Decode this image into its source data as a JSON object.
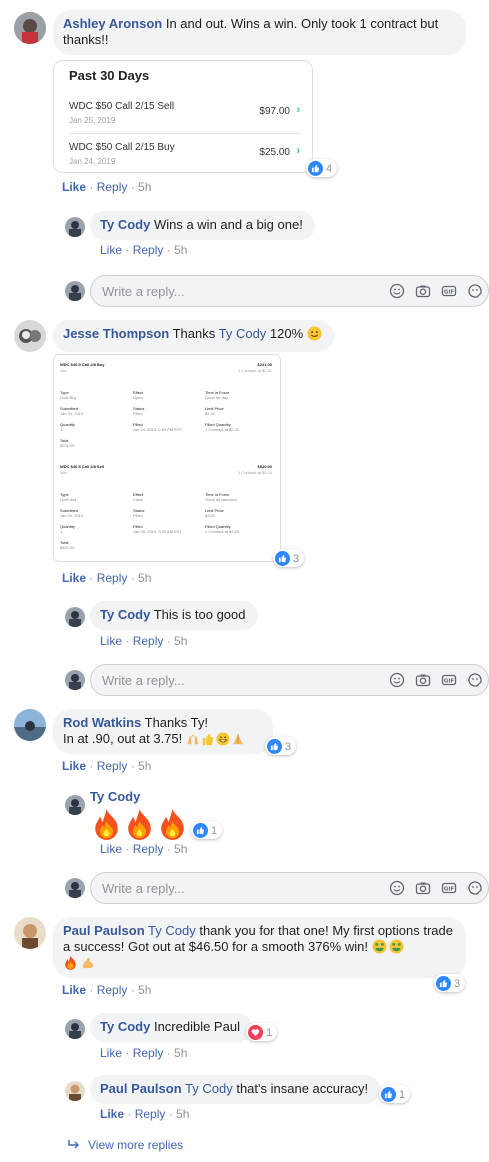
{
  "colors": {
    "link": "#385898",
    "like_blue": "#2d88ff",
    "heart_red": "#f33e58",
    "robinhood_green": "#21ce99",
    "bubble_bg": "#f2f3f5"
  },
  "actions": {
    "like": "Like",
    "reply": "Reply",
    "sep": " · "
  },
  "reply_placeholder": "Write a reply...",
  "reply_icons": [
    "smiley-icon",
    "camera-icon",
    "gif-icon",
    "sticker-icon"
  ],
  "comments": [
    {
      "author": "Ashley Aronson",
      "text": "In and out. Wins a win. Only took 1 contract but thanks!!",
      "time": "5h",
      "reactions": "4",
      "attachment": {
        "title": "Past 30 Days",
        "trades": [
          {
            "name": "WDC $50 Call 2/15 Sell",
            "date": "Jan 25, 2019",
            "amount": "$97.00"
          },
          {
            "name": "WDC $50 Call 2/15 Buy",
            "date": "Jan 24, 2019",
            "amount": "$25.00"
          }
        ]
      },
      "replies": [
        {
          "author": "Ty Cody",
          "text": "Wins a win and a big one!",
          "time": "5h"
        }
      ]
    },
    {
      "author": "Jesse Thompson",
      "mention": "Ty Cody",
      "text": "120%",
      "time": "5h",
      "reactions": "3",
      "attachment": {
        "orders": [
          {
            "title": "WDC $40.5 Call 2/8 Buy",
            "sub": "16h",
            "amount": "$231.00",
            "amount_sub": "1 Contract at $2.31",
            "fields": [
              [
                "Type",
                "Limit Buy"
              ],
              [
                "Effect",
                "Open"
              ],
              [
                "Time in Force",
                "Good for day"
              ],
              [
                "Submitted",
                "Jan 24, 2019"
              ],
              [
                "Status",
                "Filled"
              ],
              [
                "Limit Price",
                "$2.31"
              ],
              [
                "Quantity",
                "1"
              ],
              [
                "Filled",
                "Jan 24, 2019, 2:53 PM EST"
              ],
              [
                "Filled Quantity",
                "1 Contract at $2.31"
              ]
            ],
            "total_label": "Total",
            "total": "$231.00"
          },
          {
            "title": "WDC $40.5 Call 2/8 Sell",
            "sub": "16h",
            "amount": "$520.00",
            "amount_sub": "1 Contract at $5.20",
            "fields": [
              [
                "Type",
                "Limit Sell"
              ],
              [
                "Effect",
                "Close"
              ],
              [
                "Time in Force",
                "Good till canceled"
              ],
              [
                "Submitted",
                "Jan 24, 2019"
              ],
              [
                "Status",
                "Filled"
              ],
              [
                "Limit Price",
                "$3.00"
              ],
              [
                "Quantity",
                "1"
              ],
              [
                "Filled",
                "Jan 25, 2019, 9:30 AM EST"
              ],
              [
                "Filled Quantity",
                "1 Contract at $5.20"
              ]
            ],
            "total_label": "Total",
            "total": "$520.00"
          }
        ]
      },
      "replies": [
        {
          "author": "Ty Cody",
          "text": "This is too good",
          "time": "5h"
        }
      ]
    },
    {
      "author": "Rod Watkins",
      "text": "Thanks Ty!",
      "text2": "In at .90, out at 3.75!",
      "time": "5h",
      "reactions": "3",
      "replies": [
        {
          "author": "Ty Cody",
          "text": "",
          "time": "5h",
          "reactions": "1"
        }
      ]
    },
    {
      "author": "Paul Paulson",
      "mention": "Ty Cody",
      "text": "thank you for that one! My first options trade a success! Got out at $46.50 for a smooth 376% win!",
      "time": "5h",
      "reactions": "3",
      "replies": [
        {
          "author": "Ty Cody",
          "text": "Incredible Paul",
          "time": "5h",
          "reactions": "1"
        },
        {
          "author": "Paul Paulson",
          "mention": "Ty Cody",
          "text": "that's insane accuracy!",
          "time": "5h",
          "reactions": "1"
        }
      ]
    }
  ],
  "view_more": "View more replies"
}
